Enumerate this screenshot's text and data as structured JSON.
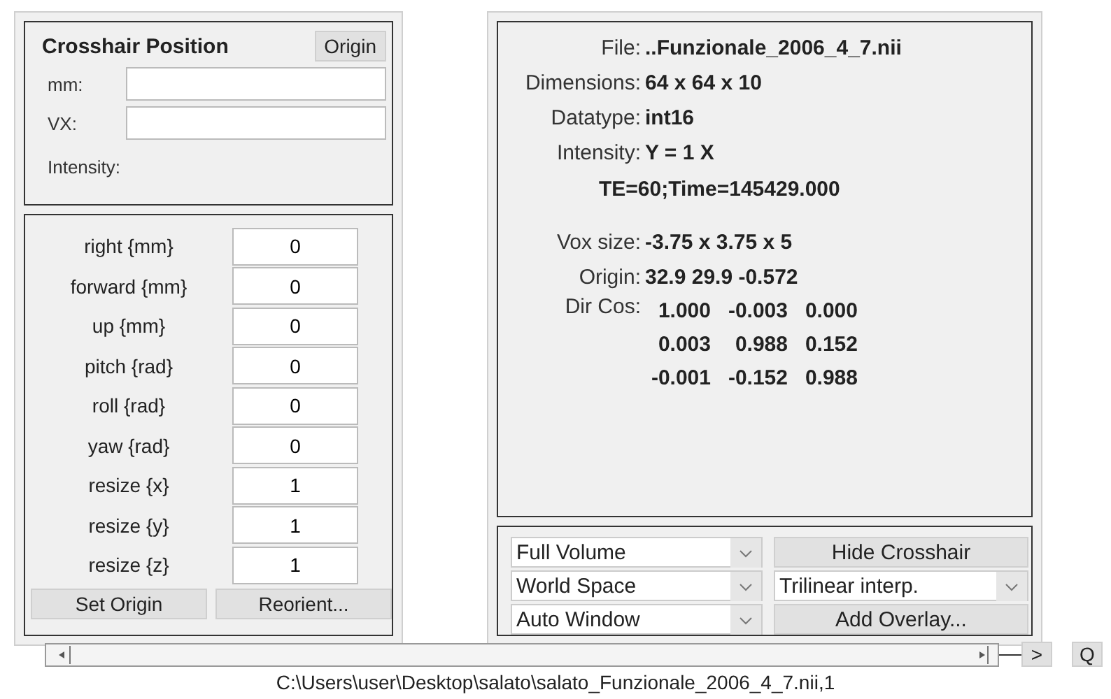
{
  "crosshair": {
    "title": "Crosshair Position",
    "origin_button": "Origin",
    "fields": [
      {
        "label": "mm:"
      },
      {
        "label": "VX:"
      }
    ],
    "intensity_label": "Intensity:"
  },
  "transform": {
    "rows": [
      {
        "label": "right {mm}",
        "value": "0"
      },
      {
        "label": "forward {mm}",
        "value": "0"
      },
      {
        "label": "up {mm}",
        "value": "0"
      },
      {
        "label": "pitch {rad}",
        "value": "0"
      },
      {
        "label": "roll {rad}",
        "value": "0"
      },
      {
        "label": "yaw {rad}",
        "value": "0"
      },
      {
        "label": "resize {x}",
        "value": "1"
      },
      {
        "label": "resize {y}",
        "value": "1"
      },
      {
        "label": "resize {z}",
        "value": "1"
      }
    ],
    "buttons": [
      "Set Origin",
      "Reorient..."
    ]
  },
  "info": {
    "rows": [
      {
        "label": "File:",
        "value": "..Funzionale_2006_4_7.nii"
      },
      {
        "label": "Dimensions:",
        "value": "64 x 64 x 10"
      },
      {
        "label": "Datatype:",
        "value": "int16"
      },
      {
        "label": "Intensity:",
        "value": "Y = 1 X"
      }
    ],
    "note": "TE=60;Time=145429.000",
    "rows2": [
      {
        "label": "Vox size:",
        "value": "-3.75 x 3.75 x 5"
      },
      {
        "label": "Origin:",
        "value": "32.9 29.9 -0.572"
      }
    ],
    "dir_cos": {
      "label": "Dir Cos:",
      "rows": [
        [
          "1.000",
          "-0.003",
          "0.000"
        ],
        [
          "0.003",
          "0.988",
          "0.152"
        ],
        [
          "-0.001",
          "-0.152",
          "0.988"
        ]
      ]
    }
  },
  "controls": {
    "dropdowns": [
      {
        "value": "Full Volume"
      },
      {
        "value": "World Space"
      },
      {
        "value": "Auto Window"
      }
    ],
    "hide_crosshair": "Hide Crosshair",
    "interp": "Trilinear interp.",
    "add_overlay": "Add Overlay..."
  },
  "nav": {
    "next": ">",
    "q": "Q"
  },
  "status": "C:\\Users\\user\\Desktop\\salato\\salato_Funzionale_2006_4_7.nii,1"
}
